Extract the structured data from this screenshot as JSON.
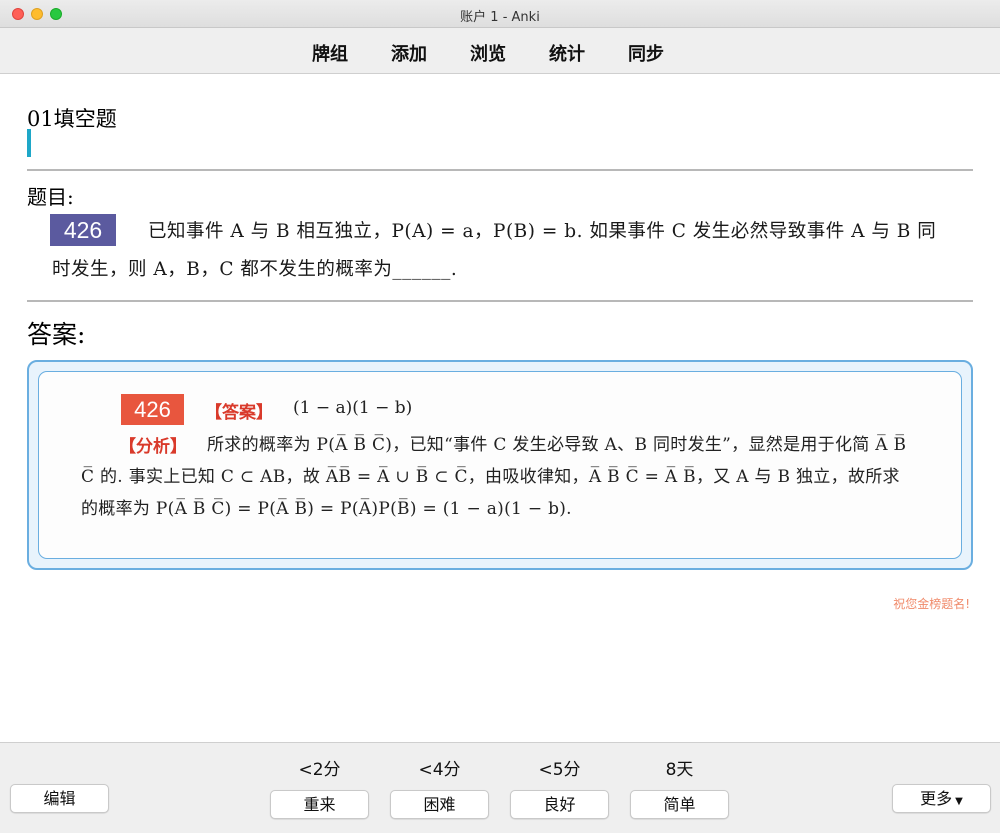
{
  "window": {
    "title": "账户 1 - Anki"
  },
  "menu": {
    "items": [
      "牌组",
      "添加",
      "浏览",
      "统计",
      "同步"
    ]
  },
  "card": {
    "deck_title": "01填空题",
    "question_label": "题目:",
    "question_number": "426",
    "question_text": "已知事件 A 与 B 相互独立，P(A) = a，P(B) = b. 如果事件 C 发生必然导致事件 A 与 B 同时发生，则 A，B，C 都不发生的概率为______.",
    "answer_label": "答案:",
    "answer_number": "426",
    "answer_tag": "【答案】",
    "answer_value": "(1 − a)(1 − b)",
    "analysis_tag": "【分析】",
    "analysis_text": "所求的概率为 P(A̅ B̅ C̅)，已知“事件 C 发生必导致 A、B 同时发生”，显然是用于化简 A̅ B̅ C̅ 的. 事实上已知 C ⊂ AB，故 A̅B̅ = A̅ ∪ B̅ ⊂ C̅，由吸收律知，A̅ B̅ C̅ = A̅ B̅，又 A 与 B 独立，故所求的概率为 P(A̅ B̅ C̅) = P(A̅ B̅) = P(A̅)P(B̅) = (1 − a)(1 − b).",
    "footer_note": "祝您金榜题名!"
  },
  "bottom": {
    "edit_label": "编辑",
    "more_label": "更多",
    "answers": [
      {
        "interval": "<2分",
        "label": "重来"
      },
      {
        "interval": "<4分",
        "label": "困难"
      },
      {
        "interval": "<5分",
        "label": "良好"
      },
      {
        "interval": "8天",
        "label": "简单"
      }
    ]
  },
  "colors": {
    "accent_bar": "#1ea7c8",
    "question_badge": "#5b5a9f",
    "answer_badge": "#e8563e",
    "answer_border": "#6aaee0"
  }
}
